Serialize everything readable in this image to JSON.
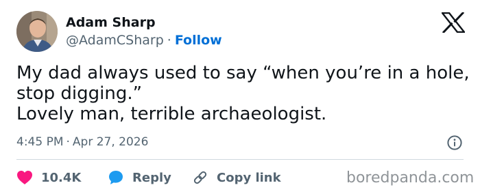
{
  "author": {
    "name": "Adam Sharp",
    "handle": "@AdamCSharp",
    "separator": "·",
    "follow_label": "Follow",
    "avatar": "profile-photo"
  },
  "brand": {
    "logo": "x-logo-icon"
  },
  "tweet": {
    "lines": [
      "My dad always used to say “when you’re in a hole,",
      "stop digging.”",
      "Lovely man, terrible archaeologist."
    ]
  },
  "meta": {
    "time": "4:45 PM",
    "separator": "·",
    "date": "Apr 27, 2026",
    "info_icon": "info-icon"
  },
  "actions": {
    "like": {
      "icon": "heart-icon",
      "label": "10.4K",
      "color": "#f91880"
    },
    "reply": {
      "icon": "speech-bubble-icon",
      "label": "Reply",
      "color": "#1d9bf0"
    },
    "copy": {
      "icon": "link-icon",
      "label": "Copy link",
      "color": "#536471"
    }
  },
  "watermark": {
    "text": "boredpanda.com"
  },
  "colors": {
    "text": "#0f1419",
    "secondary": "#536471",
    "follow": "#006fd6",
    "divider": "#cfd9de"
  }
}
